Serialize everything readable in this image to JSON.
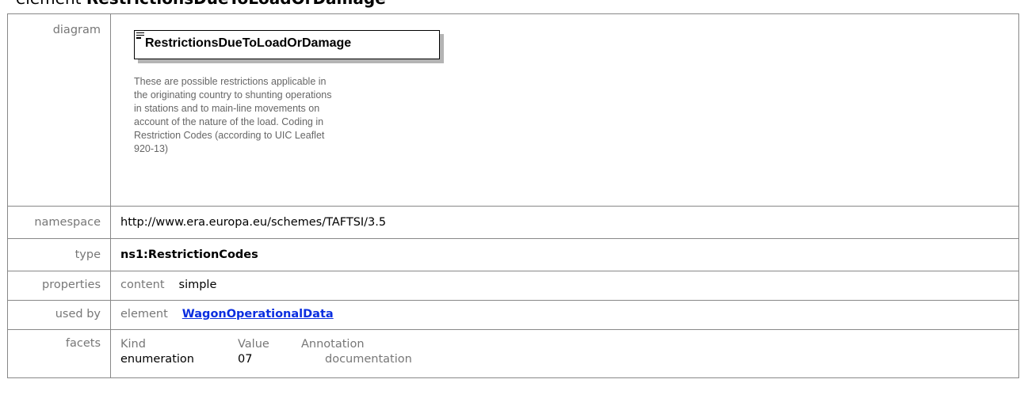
{
  "heading": {
    "prefix": "element",
    "name": "RestrictionsDueToLoadOrDamage"
  },
  "rows": {
    "diagram": {
      "label": "diagram",
      "element_name": "RestrictionsDueToLoadOrDamage",
      "documentation_lines": [
        "These are possible restrictions applicable in",
        "the originating country to shunting operations",
        "in stations and to main-line movements on",
        "account of the nature of the load. Coding in",
        "Restriction Codes (according to UIC Leaflet",
        "920-13)"
      ]
    },
    "namespace": {
      "label": "namespace",
      "value": "http://www.era.europa.eu/schemes/TAFTSI/3.5"
    },
    "type": {
      "label": "type",
      "value": "ns1:RestrictionCodes"
    },
    "properties": {
      "label": "properties",
      "key": "content",
      "value": "simple"
    },
    "used_by": {
      "label": "used by",
      "key": "element",
      "link": "WagonOperationalData"
    },
    "facets": {
      "label": "facets",
      "headers": [
        "Kind",
        "Value",
        "Annotation"
      ],
      "rows": [
        {
          "kind": "enumeration",
          "value": "07",
          "annotation": "documentation"
        }
      ]
    }
  }
}
